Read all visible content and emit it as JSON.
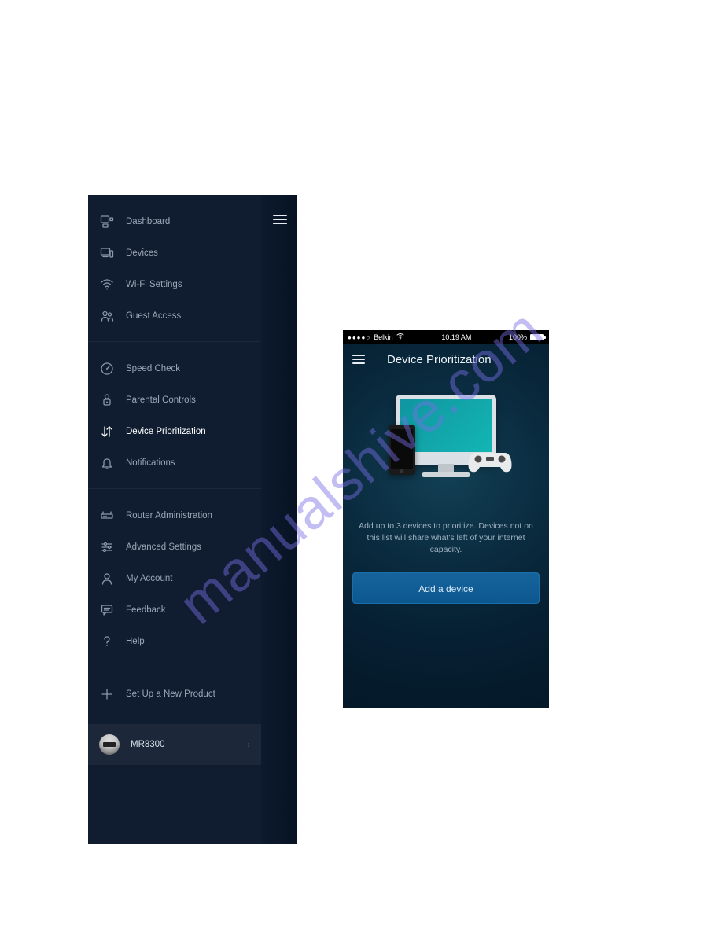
{
  "watermark": "manualshive.com",
  "sidebar": {
    "groups": [
      {
        "items": [
          {
            "id": "dashboard",
            "label": "Dashboard",
            "icon": "dashboard-icon",
            "active": false
          },
          {
            "id": "devices",
            "label": "Devices",
            "icon": "devices-icon",
            "active": false
          },
          {
            "id": "wifi",
            "label": "Wi-Fi Settings",
            "icon": "wifi-icon",
            "active": false
          },
          {
            "id": "guest",
            "label": "Guest Access",
            "icon": "guest-icon",
            "active": false
          }
        ]
      },
      {
        "items": [
          {
            "id": "speed",
            "label": "Speed Check",
            "icon": "gauge-icon",
            "active": false
          },
          {
            "id": "parental",
            "label": "Parental Controls",
            "icon": "lock-icon",
            "active": false
          },
          {
            "id": "priority",
            "label": "Device Prioritization",
            "icon": "arrows-icon",
            "active": true
          },
          {
            "id": "notify",
            "label": "Notifications",
            "icon": "bell-icon",
            "active": false
          }
        ]
      },
      {
        "items": [
          {
            "id": "routeradmin",
            "label": "Router Administration",
            "icon": "router-icon",
            "active": false
          },
          {
            "id": "advanced",
            "label": "Advanced Settings",
            "icon": "sliders-icon",
            "active": false
          },
          {
            "id": "account",
            "label": "My Account",
            "icon": "person-icon",
            "active": false
          },
          {
            "id": "feedback",
            "label": "Feedback",
            "icon": "chat-icon",
            "active": false
          },
          {
            "id": "help",
            "label": "Help",
            "icon": "question-icon",
            "active": false
          }
        ]
      },
      {
        "items": [
          {
            "id": "setup",
            "label": "Set Up a New Product",
            "icon": "plus-icon",
            "active": false
          }
        ]
      }
    ],
    "device": {
      "label": "MR8300"
    }
  },
  "detail": {
    "status_bar": {
      "signal": "●●●●○",
      "carrier": "Belkin",
      "time": "10:19 AM",
      "battery": "100%"
    },
    "title": "Device Prioritization",
    "description": "Add up to 3 devices to prioritize. Devices not on this list will share what's left of your internet capacity.",
    "button": "Add a device"
  }
}
